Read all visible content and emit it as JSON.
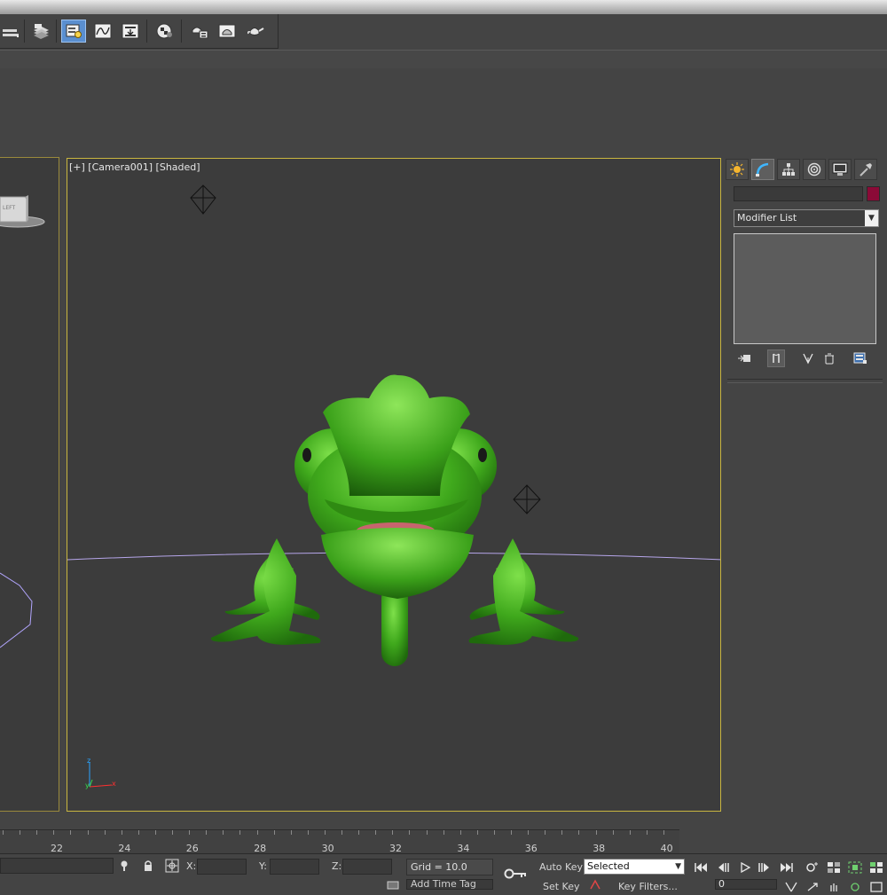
{
  "toolbar": {
    "buttons": [
      {
        "icon": "layer-stack-icon",
        "active": false
      },
      {
        "icon": "layer-manager-icon",
        "active": false
      },
      {
        "icon": "scene-explorer-icon",
        "active": true
      },
      {
        "icon": "curve-editor-icon",
        "active": false
      },
      {
        "icon": "schematic-view-icon",
        "active": false
      },
      {
        "icon": "material-editor-icon",
        "active": false
      },
      {
        "icon": "render-setup-icon",
        "active": false
      },
      {
        "icon": "rendered-frame-window-icon",
        "active": false
      },
      {
        "icon": "render-teapot-icon",
        "active": false
      }
    ]
  },
  "viewport": {
    "label": "[+] [Camera001] [Shaded]",
    "axis_labels": {
      "z": "z",
      "x": "x",
      "y": "y"
    }
  },
  "left_viewport": {
    "cube_label": "LEFT"
  },
  "command_panel": {
    "tabs": [
      "create-tab",
      "modify-tab",
      "hierarchy-tab",
      "motion-tab",
      "display-tab",
      "utilities-tab"
    ],
    "active_tab": "modify-tab",
    "object_name": "",
    "object_color": "#8b0a37",
    "modifier_list": "Modifier List"
  },
  "timeline": {
    "ticks": [
      "22",
      "24",
      "26",
      "28",
      "30",
      "32",
      "34",
      "36",
      "38",
      "40"
    ]
  },
  "statusbar": {
    "x_label": "X:",
    "y_label": "Y:",
    "z_label": "Z:",
    "x_value": "",
    "y_value": "",
    "z_value": "",
    "grid": "Grid = 10.0",
    "auto_key": "Auto Key",
    "set_key": "Set Key",
    "selected": "Selected",
    "key_filters": "Key Filters...",
    "add_time_tag": "Add Time Tag",
    "frame": "0"
  }
}
